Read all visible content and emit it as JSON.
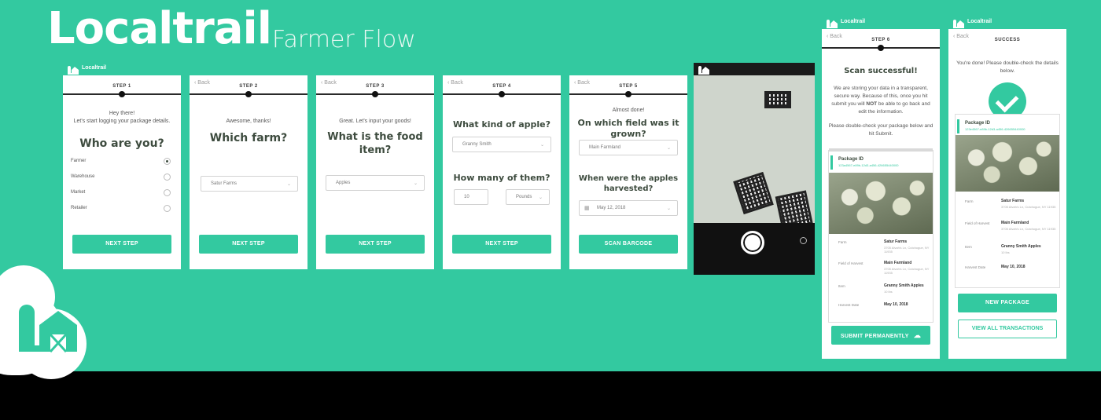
{
  "brand": "Localtrail",
  "flow_title": "Farmer Flow",
  "app_name": "Localtrail",
  "back_label": "Back",
  "colors": {
    "accent": "#33c9a0",
    "heading": "#3d4b3e"
  },
  "screen1": {
    "step": "STEP 1",
    "greeting": "Hey there!",
    "intro": "Let's start logging your package details.",
    "heading": "Who are you?",
    "roles": [
      "Farmer",
      "Warehouse",
      "Market",
      "Retailer"
    ],
    "selected_role": "Farmer",
    "button": "NEXT STEP"
  },
  "screen2": {
    "step": "STEP 2",
    "subtext": "Awesome, thanks!",
    "heading": "Which farm?",
    "farm_value": "Satur Farms",
    "button": "NEXT STEP"
  },
  "screen3": {
    "step": "STEP 3",
    "subtext": "Great. Let's input your goods!",
    "heading": "What is the food item?",
    "item_value": "Apples",
    "button": "NEXT STEP"
  },
  "screen4": {
    "step": "STEP 4",
    "heading_kind": "What kind of apple?",
    "kind_value": "Granny Smith",
    "heading_qty": "How many of them?",
    "qty_value": "10",
    "unit_value": "Pounds",
    "button": "NEXT STEP"
  },
  "screen5": {
    "step": "STEP 5",
    "subtext": "Almost done!",
    "heading_field": "On which field was it grown?",
    "field_value": "Main Farmland",
    "heading_date": "When were the apples harvested?",
    "date_value": "May 12, 2018",
    "button": "SCAN BARCODE"
  },
  "screen7": {
    "step": "STEP 6",
    "heading": "Scan successful!",
    "body_1": "We are storing your data in a transparent, secure way. Because of this, once you hit submit you will",
    "body_not": "NOT",
    "body_2": "be able to go back and edit the information.",
    "body_3": "Please double-check your package below and hit Submit.",
    "package_label": "Package ID",
    "package_id": "123a4567-e89b-12d3-a456-426655440000",
    "rows": [
      {
        "key": "Farm",
        "value": "Satur Farms",
        "sub": "3705 Alvah's Ln, Cutchogue, NY 11935"
      },
      {
        "key": "Field of Harvest",
        "value": "Main Farmland",
        "sub": "3705 Alvah's Ln, Cutchogue, NY 11935"
      },
      {
        "key": "Item",
        "value": "Granny Smith Apples",
        "sub": "10 lbs"
      },
      {
        "key": "Harvest Date",
        "value": "May 10, 2018",
        "sub": ""
      }
    ],
    "button": "SUBMIT PERMANENTLY"
  },
  "screen8": {
    "step": "SUCCESS",
    "subtext": "You're done! Please double-check the details below.",
    "package_label": "Package ID",
    "package_id": "123e4567-e89b-12d3-a456-426655440000",
    "rows": [
      {
        "key": "Farm",
        "value": "Satur Farms",
        "sub": "3705 Alvah's Ln, Cutchogue, NY 11935"
      },
      {
        "key": "Field of Harvest",
        "value": "Main Farmland",
        "sub": "3705 Alvah's Ln, Cutchogue, NY 11935"
      },
      {
        "key": "Item",
        "value": "Granny Smith Apples",
        "sub": "10 lbs"
      },
      {
        "key": "Harvest Date",
        "value": "May 10, 2018",
        "sub": ""
      }
    ],
    "button_primary": "NEW PACKAGE",
    "button_secondary": "VIEW ALL TRANSACTIONS"
  }
}
